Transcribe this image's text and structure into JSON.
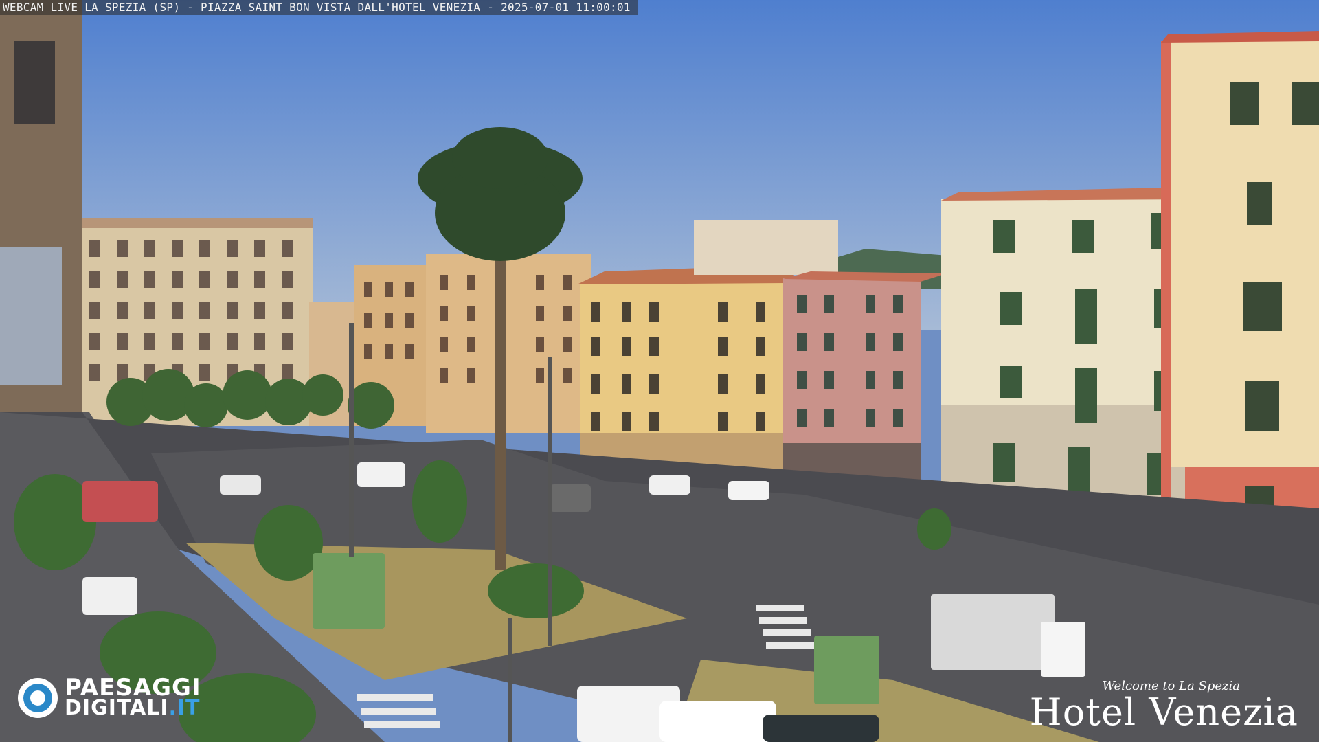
{
  "overlay": {
    "caption": "WEBCAM LIVE LA SPEZIA (SP) - PIAZZA SAINT BON VISTA DALL'HOTEL VENEZIA - 2025-07-01 11:00:01",
    "logo_left": {
      "line1": "PAESAGGI",
      "line2a": "DIGITALI",
      "line2b": ".IT"
    },
    "logo_right": {
      "welcome": "Welcome to La Spezia",
      "name": "Hotel Venezia"
    }
  },
  "colors": {
    "sky": "#5f86c8",
    "accent_logo": "#2a88c8",
    "road": "#4a4a4e",
    "grass": "#8a8a55"
  }
}
